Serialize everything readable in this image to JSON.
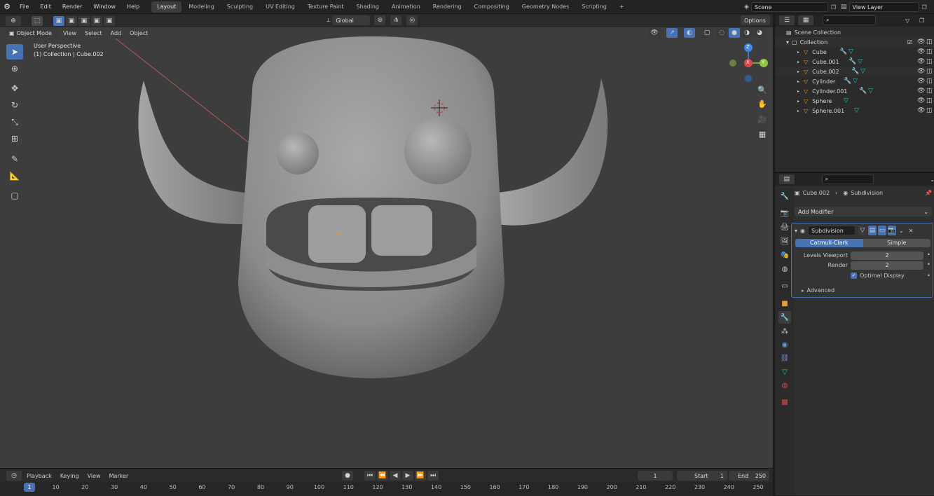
{
  "topbar": {
    "menus": [
      "File",
      "Edit",
      "Render",
      "Window",
      "Help"
    ],
    "workspaces": [
      "Layout",
      "Modeling",
      "Sculpting",
      "UV Editing",
      "Texture Paint",
      "Shading",
      "Animation",
      "Rendering",
      "Compositing",
      "Geometry Nodes",
      "Scripting"
    ],
    "add_tab": "+",
    "scene": "Scene",
    "view_layer": "View Layer"
  },
  "viewport_header": {
    "mode": "Object Mode",
    "menus": [
      "View",
      "Select",
      "Add",
      "Object"
    ],
    "orientation": "Global",
    "options": "Options"
  },
  "viewport": {
    "perspective": "User Perspective",
    "collection_info": "(1) Collection | Cube.002",
    "gizmo": {
      "x": "X",
      "y": "Y",
      "z": "Z"
    }
  },
  "outliner": {
    "search_placeholder": "",
    "scene_collection": "Scene Collection",
    "collection": "Collection",
    "items": [
      "Cube",
      "Cube.001",
      "Cube.002",
      "Cylinder",
      "Cylinder.001",
      "Sphere",
      "Sphere.001"
    ]
  },
  "properties": {
    "object_name": "Cube.002",
    "modifier_name_crumb": "Subdivision",
    "add_modifier": "Add Modifier",
    "modifier": {
      "name": "Subdivision",
      "mode_catmull": "Catmull-Clark",
      "mode_simple": "Simple",
      "levels_viewport_label": "Levels Viewport",
      "levels_viewport_value": "2",
      "render_label": "Render",
      "render_value": "2",
      "optimal_display": "Optimal Display",
      "advanced": "Advanced"
    }
  },
  "timeline": {
    "menus": [
      "Playback",
      "Keying",
      "View",
      "Marker"
    ],
    "current_frame": "1",
    "start_label": "Start",
    "start_value": "1",
    "end_label": "End",
    "end_value": "250",
    "ticks": [
      "1",
      "10",
      "20",
      "30",
      "40",
      "50",
      "60",
      "70",
      "80",
      "90",
      "100",
      "110",
      "120",
      "130",
      "140",
      "150",
      "160",
      "170",
      "180",
      "190",
      "200",
      "210",
      "220",
      "230",
      "240",
      "250"
    ]
  },
  "colors": {
    "accent": "#4772b3",
    "x_axis": "#e0454f",
    "y_axis": "#8cc63f",
    "z_axis": "#3b8ced",
    "mesh_icon": "#27c3a7",
    "object_icon": "#e89c3a"
  }
}
